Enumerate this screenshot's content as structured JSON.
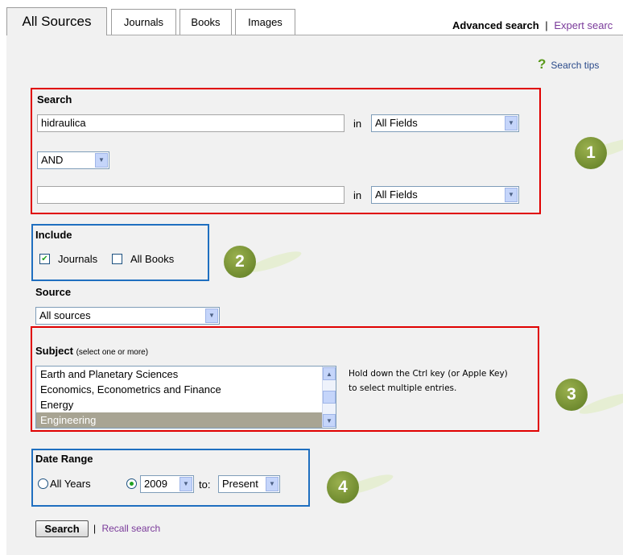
{
  "tabs": [
    {
      "label": "All Sources",
      "active": true
    },
    {
      "label": "Journals"
    },
    {
      "label": "Books"
    },
    {
      "label": "Images"
    }
  ],
  "header": {
    "advanced_label": "Advanced search",
    "separator": "|",
    "expert_label": "Expert searc"
  },
  "search_tips": {
    "icon": "?",
    "label": "Search tips"
  },
  "search": {
    "label": "Search",
    "term1": "hidraulica",
    "in_label": "in",
    "field1": "All Fields",
    "operator": "AND",
    "term2": "",
    "field2": "All Fields"
  },
  "include": {
    "label": "Include",
    "journals_label": "Journals",
    "journals_checked": true,
    "books_label": "All Books",
    "books_checked": false
  },
  "source": {
    "label": "Source",
    "value": "All sources"
  },
  "subject": {
    "label": "Subject",
    "note": "(select one or more)",
    "items": [
      "Earth and Planetary Sciences",
      "Economics, Econometrics and Finance",
      "Energy",
      "Engineering"
    ],
    "selected": "Engineering",
    "hint_line1": "Hold down the Ctrl key (or Apple Key)",
    "hint_line2": "to select multiple entries."
  },
  "date_range": {
    "label": "Date Range",
    "all_years_label": "All Years",
    "from_year": "2009",
    "to_label": "to:",
    "to_value": "Present"
  },
  "actions": {
    "search_button": "Search",
    "separator": "|",
    "recall_label": "Recall search"
  },
  "badges": [
    "1",
    "2",
    "3",
    "4"
  ],
  "colors": {
    "highlight_red": "#e00000",
    "highlight_blue": "#1f6fc0",
    "badge_green": "#6f8a2c",
    "link_purple": "#7a3a9a"
  }
}
